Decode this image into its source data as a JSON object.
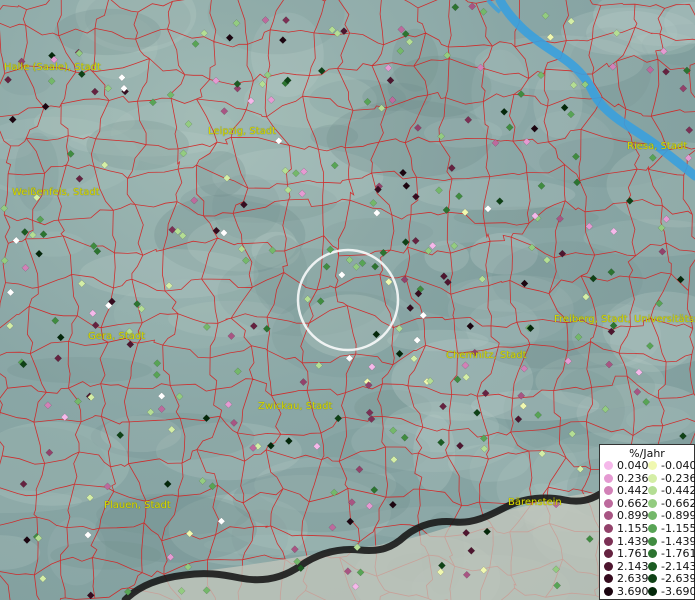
{
  "map": {
    "cities": [
      {
        "id": "halle",
        "label": "Halle (Saale), Stadt"
      },
      {
        "id": "leipzig",
        "label": "Leipzig, Stadt"
      },
      {
        "id": "riesa",
        "label": "Riesa, Stadt"
      },
      {
        "id": "weissenfels",
        "label": "Weißenfels, Stadt"
      },
      {
        "id": "gera",
        "label": "Gera, Stadt"
      },
      {
        "id": "freiberg",
        "label": "Freiberg, Stadt, Universitätsstadt"
      },
      {
        "id": "chemnitz",
        "label": "Chemnitz, Stadt"
      },
      {
        "id": "zwickau",
        "label": "Zwickau, Stadt"
      },
      {
        "id": "plauen",
        "label": "Plauen, Stadt"
      },
      {
        "id": "barenstein",
        "label": "Bärenstein"
      }
    ],
    "colors": {
      "boundary": "#d42020",
      "river": "#3aa0dd",
      "border": "#1a1a1a",
      "selection_ring": "#ffffff"
    }
  },
  "legend": {
    "title": "%/Jahr",
    "positive": [
      {
        "label": "0.040",
        "color": "#f5b8ea"
      },
      {
        "label": "0.236",
        "color": "#e59ad2"
      },
      {
        "label": "0.442",
        "color": "#d281b7"
      },
      {
        "label": "0.662",
        "color": "#bd6a9d"
      },
      {
        "label": "0.899",
        "color": "#a85583"
      },
      {
        "label": "1.155",
        "color": "#93426b"
      },
      {
        "label": "1.439",
        "color": "#7c3055"
      },
      {
        "label": "1.761",
        "color": "#652240"
      },
      {
        "label": "2.143",
        "color": "#4e162f"
      },
      {
        "label": "2.639",
        "color": "#360c1f"
      },
      {
        "label": "3.690",
        "color": "#1c0510"
      }
    ],
    "negative": [
      {
        "label": "-0.040",
        "color": "#f0f8b0"
      },
      {
        "label": "-0.236",
        "color": "#d4eea6"
      },
      {
        "label": "-0.442",
        "color": "#b4de94"
      },
      {
        "label": "-0.662",
        "color": "#93cc80"
      },
      {
        "label": "-0.899",
        "color": "#74b86a"
      },
      {
        "label": "-1.155",
        "color": "#58a455"
      },
      {
        "label": "-1.439",
        "color": "#408c40"
      },
      {
        "label": "-1.761",
        "color": "#2c7430"
      },
      {
        "label": "-2.143",
        "color": "#1c5c22"
      },
      {
        "label": "-2.639",
        "color": "#0f4216"
      },
      {
        "label": "-3.690",
        "color": "#04280a"
      }
    ]
  }
}
